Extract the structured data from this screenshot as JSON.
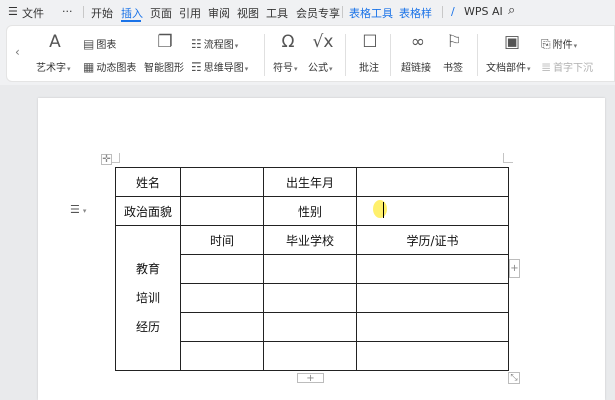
{
  "menubar": {
    "hamburger": "☰",
    "file": "文件",
    "more": "···",
    "items": [
      "开始",
      "插入",
      "页面",
      "引用",
      "审阅",
      "视图",
      "工具",
      "会员专享"
    ],
    "context_tabs": [
      "表格工具",
      "表格样"
    ],
    "wps_ai": "WPS AI",
    "search_icon": "search-icon"
  },
  "ribbon": {
    "art_text": "艺术字",
    "chart": "图表",
    "dynamic_chart": "动态图表",
    "smart_shape": "智能图形",
    "flowchart": "流程图",
    "mindmap": "思维导图",
    "symbol": "符号",
    "formula": "公式",
    "comment": "批注",
    "hyperlink": "超链接",
    "bookmark": "书签",
    "doc_parts": "文档部件",
    "attachment": "附件",
    "drop_cap": "首字下沉"
  },
  "table": {
    "name_label": "姓名",
    "birth_label": "出生年月",
    "politics_label": "政治面貌",
    "gender_label": "性别",
    "edu_label_lines": [
      "教育",
      "培训",
      "经历"
    ],
    "col_time": "时间",
    "col_school": "毕业学校",
    "col_degree": "学历/证书"
  },
  "colors": {
    "accent": "#1a73e8",
    "highlight": "#ffeb3b"
  }
}
